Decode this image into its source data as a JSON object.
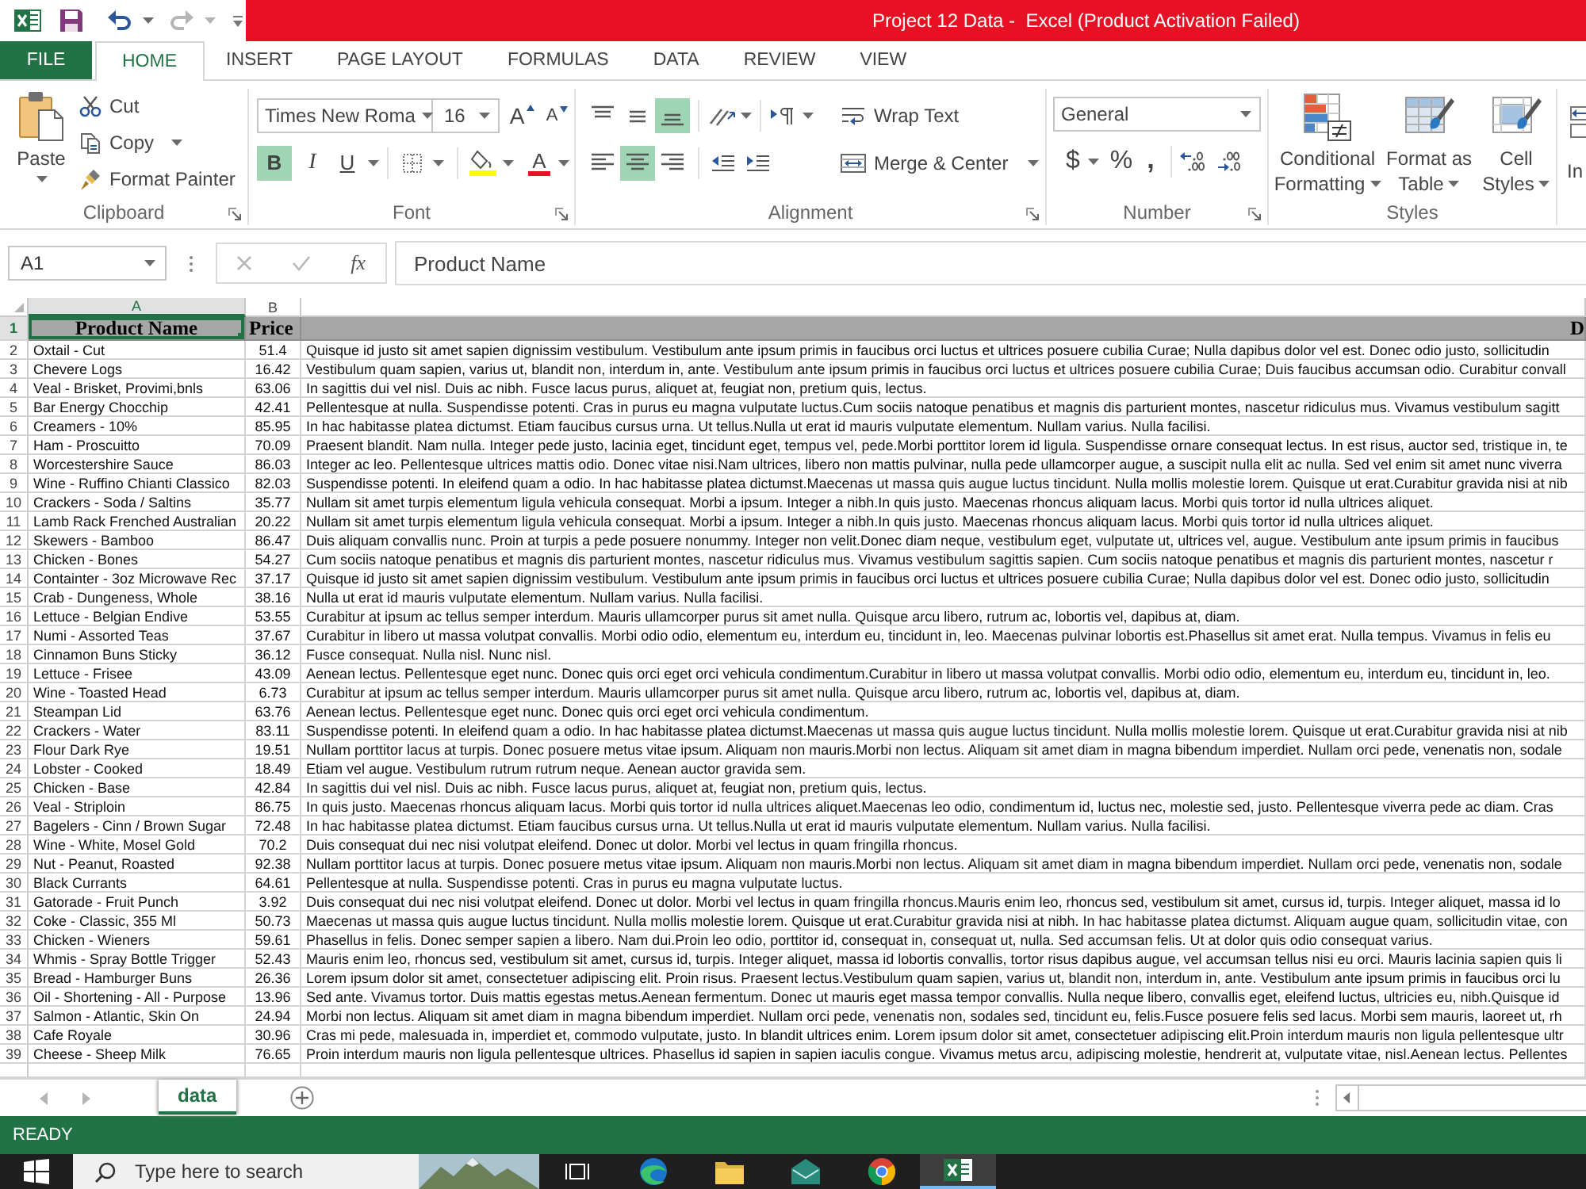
{
  "window": {
    "title": "Project 12 Data -  Excel (Product Activation Failed)"
  },
  "ribbon_tabs": [
    {
      "label": "FILE",
      "kind": "file",
      "selected": false
    },
    {
      "label": "HOME",
      "kind": "tab",
      "selected": true
    },
    {
      "label": "INSERT",
      "kind": "tab",
      "selected": false
    },
    {
      "label": "PAGE LAYOUT",
      "kind": "tab",
      "selected": false
    },
    {
      "label": "FORMULAS",
      "kind": "tab",
      "selected": false
    },
    {
      "label": "DATA",
      "kind": "tab",
      "selected": false
    },
    {
      "label": "REVIEW",
      "kind": "tab",
      "selected": false
    },
    {
      "label": "VIEW",
      "kind": "tab",
      "selected": false
    }
  ],
  "clipboard": {
    "paste": "Paste",
    "cut": "Cut",
    "copy": "Copy",
    "format_painter": "Format Painter",
    "label": "Clipboard"
  },
  "font": {
    "name": "Times New Roma",
    "size": "16",
    "grow": "A",
    "shrink": "A",
    "bold": {
      "label": "B",
      "on": true
    },
    "italic": {
      "label": "I",
      "on": false
    },
    "underline": {
      "label": "U",
      "on": false
    },
    "font_color": "A",
    "label": "Font"
  },
  "alignment": {
    "vertical": [
      {
        "kind": "top",
        "selected": false
      },
      {
        "kind": "middle",
        "selected": false
      },
      {
        "kind": "bottom",
        "selected": true
      }
    ],
    "horizontal": [
      {
        "kind": "left",
        "selected": false
      },
      {
        "kind": "center",
        "selected": true
      },
      {
        "kind": "right",
        "selected": false
      }
    ],
    "wrap_text": "Wrap Text",
    "merge_center": "Merge & Center",
    "label": "Alignment"
  },
  "number": {
    "format": "General",
    "currency": "$",
    "percent": "%",
    "comma": ",",
    "label": "Number"
  },
  "styles": {
    "buttons": [
      "Conditional\nFormatting",
      "Format as\nTable",
      "Cell\nStyles"
    ],
    "label": "Styles"
  },
  "cells": {
    "insert": "In"
  },
  "formula_bar": {
    "name_box": "A1",
    "function_label": "fx",
    "formula": "Product Name"
  },
  "sheet": {
    "columns": [
      {
        "letter": "A",
        "heading": "Product Name",
        "selected": true
      },
      {
        "letter": "B",
        "heading": "Price",
        "selected": false
      },
      {
        "heading": "D",
        "selected": false
      }
    ],
    "header_row": {
      "number": "1",
      "selected": true
    },
    "rows": [
      {
        "number": "2",
        "product_name": "Oxtail - Cut",
        "price": "51.4",
        "description": "Quisque id justo sit amet sapien dignissim vestibulum. Vestibulum ante ipsum primis in faucibus orci luctus et ultrices posuere cubilia Curae; Nulla dapibus dolor vel est. Donec odio justo, sollicitudin"
      },
      {
        "number": "3",
        "product_name": "Chevere Logs",
        "price": "16.42",
        "description": "Vestibulum quam sapien, varius ut, blandit non, interdum in, ante. Vestibulum ante ipsum primis in faucibus orci luctus et ultrices posuere cubilia Curae; Duis faucibus accumsan odio. Curabitur convall"
      },
      {
        "number": "4",
        "product_name": "Veal - Brisket, Provimi,bnls",
        "price": "63.06",
        "description": "In sagittis dui vel nisl. Duis ac nibh. Fusce lacus purus, aliquet at, feugiat non, pretium quis, lectus."
      },
      {
        "number": "5",
        "product_name": "Bar Energy Chocchip",
        "price": "42.41",
        "description": "Pellentesque at nulla. Suspendisse potenti. Cras in purus eu magna vulputate luctus.Cum sociis natoque penatibus et magnis dis parturient montes, nascetur ridiculus mus. Vivamus vestibulum sagitt"
      },
      {
        "number": "6",
        "product_name": "Creamers - 10%",
        "price": "85.95",
        "description": "In hac habitasse platea dictumst. Etiam faucibus cursus urna. Ut tellus.Nulla ut erat id mauris vulputate elementum. Nullam varius. Nulla facilisi."
      },
      {
        "number": "7",
        "product_name": "Ham - Proscuitto",
        "price": "70.09",
        "description": "Praesent blandit. Nam nulla. Integer pede justo, lacinia eget, tincidunt eget, tempus vel, pede.Morbi porttitor lorem id ligula. Suspendisse ornare consequat lectus. In est risus, auctor sed, tristique in, te"
      },
      {
        "number": "8",
        "product_name": "Worcestershire Sauce",
        "price": "86.03",
        "description": "Integer ac leo. Pellentesque ultrices mattis odio. Donec vitae nisi.Nam ultrices, libero non mattis pulvinar, nulla pede ullamcorper augue, a suscipit nulla elit ac nulla. Sed vel enim sit amet nunc viverra"
      },
      {
        "number": "9",
        "product_name": "Wine - Ruffino Chianti Classico",
        "price": "82.03",
        "description": "Suspendisse potenti. In eleifend quam a odio. In hac habitasse platea dictumst.Maecenas ut massa quis augue luctus tincidunt. Nulla mollis molestie lorem. Quisque ut erat.Curabitur gravida nisi at nib"
      },
      {
        "number": "10",
        "product_name": "Crackers - Soda / Saltins",
        "price": "35.77",
        "description": "Nullam sit amet turpis elementum ligula vehicula consequat. Morbi a ipsum. Integer a nibh.In quis justo. Maecenas rhoncus aliquam lacus. Morbi quis tortor id nulla ultrices aliquet."
      },
      {
        "number": "11",
        "product_name": "Lamb Rack Frenched Australian",
        "price": "20.22",
        "description": "Nullam sit amet turpis elementum ligula vehicula consequat. Morbi a ipsum. Integer a nibh.In quis justo. Maecenas rhoncus aliquam lacus. Morbi quis tortor id nulla ultrices aliquet."
      },
      {
        "number": "12",
        "product_name": "Skewers - Bamboo",
        "price": "86.47",
        "description": "Duis aliquam convallis nunc. Proin at turpis a pede posuere nonummy. Integer non velit.Donec diam neque, vestibulum eget, vulputate ut, ultrices vel, augue. Vestibulum ante ipsum primis in faucibus"
      },
      {
        "number": "13",
        "product_name": "Chicken - Bones",
        "price": "54.27",
        "description": "Cum sociis natoque penatibus et magnis dis parturient montes, nascetur ridiculus mus. Vivamus vestibulum sagittis sapien. Cum sociis natoque penatibus et magnis dis parturient montes, nascetur r"
      },
      {
        "number": "14",
        "product_name": "Containter - 3oz Microwave Rec",
        "price": "37.17",
        "description": "Quisque id justo sit amet sapien dignissim vestibulum. Vestibulum ante ipsum primis in faucibus orci luctus et ultrices posuere cubilia Curae; Nulla dapibus dolor vel est. Donec odio justo, sollicitudin"
      },
      {
        "number": "15",
        "product_name": "Crab - Dungeness, Whole",
        "price": "38.16",
        "description": "Nulla ut erat id mauris vulputate elementum. Nullam varius. Nulla facilisi."
      },
      {
        "number": "16",
        "product_name": "Lettuce - Belgian Endive",
        "price": "53.55",
        "description": "Curabitur at ipsum ac tellus semper interdum. Mauris ullamcorper purus sit amet nulla. Quisque arcu libero, rutrum ac, lobortis vel, dapibus at, diam."
      },
      {
        "number": "17",
        "product_name": "Numi - Assorted Teas",
        "price": "37.67",
        "description": "Curabitur in libero ut massa volutpat convallis. Morbi odio odio, elementum eu, interdum eu, tincidunt in, leo. Maecenas pulvinar lobortis est.Phasellus sit amet erat. Nulla tempus. Vivamus in felis eu"
      },
      {
        "number": "18",
        "product_name": "Cinnamon Buns Sticky",
        "price": "36.12",
        "description": "Fusce consequat. Nulla nisl. Nunc nisl."
      },
      {
        "number": "19",
        "product_name": "Lettuce - Frisee",
        "price": "43.09",
        "description": "Aenean lectus. Pellentesque eget nunc. Donec quis orci eget orci vehicula condimentum.Curabitur in libero ut massa volutpat convallis. Morbi odio odio, elementum eu, interdum eu, tincidunt in, leo."
      },
      {
        "number": "20",
        "product_name": "Wine - Toasted Head",
        "price": "6.73",
        "description": "Curabitur at ipsum ac tellus semper interdum. Mauris ullamcorper purus sit amet nulla. Quisque arcu libero, rutrum ac, lobortis vel, dapibus at, diam."
      },
      {
        "number": "21",
        "product_name": "Steampan Lid",
        "price": "63.76",
        "description": "Aenean lectus. Pellentesque eget nunc. Donec quis orci eget orci vehicula condimentum."
      },
      {
        "number": "22",
        "product_name": "Crackers - Water",
        "price": "83.11",
        "description": "Suspendisse potenti. In eleifend quam a odio. In hac habitasse platea dictumst.Maecenas ut massa quis augue luctus tincidunt. Nulla mollis molestie lorem. Quisque ut erat.Curabitur gravida nisi at nib"
      },
      {
        "number": "23",
        "product_name": "Flour Dark Rye",
        "price": "19.51",
        "description": "Nullam porttitor lacus at turpis. Donec posuere metus vitae ipsum. Aliquam non mauris.Morbi non lectus. Aliquam sit amet diam in magna bibendum imperdiet. Nullam orci pede, venenatis non, sodale"
      },
      {
        "number": "24",
        "product_name": "Lobster - Cooked",
        "price": "18.49",
        "description": "Etiam vel augue. Vestibulum rutrum rutrum neque. Aenean auctor gravida sem."
      },
      {
        "number": "25",
        "product_name": "Chicken - Base",
        "price": "42.84",
        "description": "In sagittis dui vel nisl. Duis ac nibh. Fusce lacus purus, aliquet at, feugiat non, pretium quis, lectus."
      },
      {
        "number": "26",
        "product_name": "Veal - Striploin",
        "price": "86.75",
        "description": "In quis justo. Maecenas rhoncus aliquam lacus. Morbi quis tortor id nulla ultrices aliquet.Maecenas leo odio, condimentum id, luctus nec, molestie sed, justo. Pellentesque viverra pede ac diam. Cras"
      },
      {
        "number": "27",
        "product_name": "Bagelers - Cinn / Brown Sugar",
        "price": "72.48",
        "description": "In hac habitasse platea dictumst. Etiam faucibus cursus urna. Ut tellus.Nulla ut erat id mauris vulputate elementum. Nullam varius. Nulla facilisi."
      },
      {
        "number": "28",
        "product_name": "Wine - White, Mosel Gold",
        "price": "70.2",
        "description": "Duis consequat dui nec nisi volutpat eleifend. Donec ut dolor. Morbi vel lectus in quam fringilla rhoncus."
      },
      {
        "number": "29",
        "product_name": "Nut - Peanut, Roasted",
        "price": "92.38",
        "description": "Nullam porttitor lacus at turpis. Donec posuere metus vitae ipsum. Aliquam non mauris.Morbi non lectus. Aliquam sit amet diam in magna bibendum imperdiet. Nullam orci pede, venenatis non, sodale"
      },
      {
        "number": "30",
        "product_name": "Black Currants",
        "price": "64.61",
        "description": "Pellentesque at nulla. Suspendisse potenti. Cras in purus eu magna vulputate luctus."
      },
      {
        "number": "31",
        "product_name": "Gatorade - Fruit Punch",
        "price": "3.92",
        "description": "Duis consequat dui nec nisi volutpat eleifend. Donec ut dolor. Morbi vel lectus in quam fringilla rhoncus.Mauris enim leo, rhoncus sed, vestibulum sit amet, cursus id, turpis. Integer aliquet, massa id lo"
      },
      {
        "number": "32",
        "product_name": "Coke - Classic, 355 Ml",
        "price": "50.73",
        "description": "Maecenas ut massa quis augue luctus tincidunt. Nulla mollis molestie lorem. Quisque ut erat.Curabitur gravida nisi at nibh. In hac habitasse platea dictumst. Aliquam augue quam, sollicitudin vitae, con"
      },
      {
        "number": "33",
        "product_name": "Chicken - Wieners",
        "price": "59.61",
        "description": "Phasellus in felis. Donec semper sapien a libero. Nam dui.Proin leo odio, porttitor id, consequat in, consequat ut, nulla. Sed accumsan felis. Ut at dolor quis odio consequat varius."
      },
      {
        "number": "34",
        "product_name": "Whmis - Spray Bottle Trigger",
        "price": "52.43",
        "description": "Mauris enim leo, rhoncus sed, vestibulum sit amet, cursus id, turpis. Integer aliquet, massa id lobortis convallis, tortor risus dapibus augue, vel accumsan tellus nisi eu orci. Mauris lacinia sapien quis li"
      },
      {
        "number": "35",
        "product_name": "Bread - Hamburger Buns",
        "price": "26.36",
        "description": "Lorem ipsum dolor sit amet, consectetuer adipiscing elit. Proin risus. Praesent lectus.Vestibulum quam sapien, varius ut, blandit non, interdum in, ante. Vestibulum ante ipsum primis in faucibus orci lu"
      },
      {
        "number": "36",
        "product_name": "Oil - Shortening - All - Purpose",
        "price": "13.96",
        "description": "Sed ante. Vivamus tortor. Duis mattis egestas metus.Aenean fermentum. Donec ut mauris eget massa tempor convallis. Nulla neque libero, convallis eget, eleifend luctus, ultricies eu, nibh.Quisque id"
      },
      {
        "number": "37",
        "product_name": "Salmon - Atlantic, Skin On",
        "price": "24.94",
        "description": "Morbi non lectus. Aliquam sit amet diam in magna bibendum imperdiet. Nullam orci pede, venenatis non, sodales sed, tincidunt eu, felis.Fusce posuere felis sed lacus. Morbi sem mauris, laoreet ut, rh"
      },
      {
        "number": "38",
        "product_name": "Cafe Royale",
        "price": "30.96",
        "description": "Cras mi pede, malesuada in, imperdiet et, commodo vulputate, justo. In blandit ultrices enim. Lorem ipsum dolor sit amet, consectetuer adipiscing elit.Proin interdum mauris non ligula pellentesque ultr"
      },
      {
        "number": "39",
        "product_name": "Cheese - Sheep Milk",
        "price": "76.65",
        "description": "Proin interdum mauris non ligula pellentesque ultrices. Phasellus id sapien in sapien iaculis congue. Vivamus metus arcu, adipiscing molestie, hendrerit at, vulputate vitae, nisl.Aenean lectus. Pellentes"
      }
    ]
  },
  "sheet_tabs": [
    {
      "label": "data",
      "selected": true
    }
  ],
  "status_bar": {
    "mode": "READY"
  },
  "taskbar": {
    "search_placeholder": "Type here to search",
    "apps": [
      {
        "selected": false
      },
      {
        "selected": false
      },
      {
        "selected": false
      },
      {
        "selected": false
      },
      {
        "selected": false
      },
      {
        "selected": true
      }
    ]
  }
}
